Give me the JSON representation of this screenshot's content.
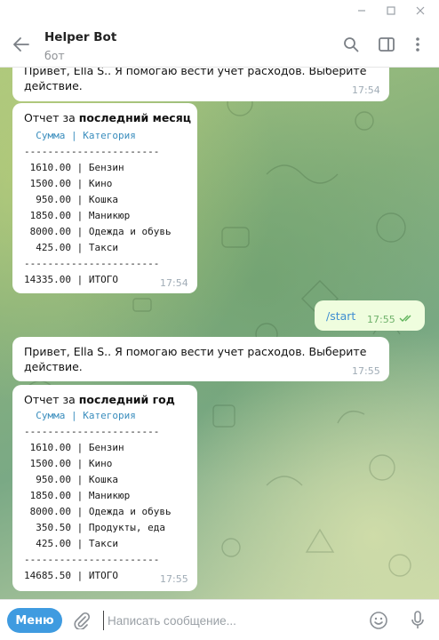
{
  "window": {
    "minimize_icon": "minimize-icon",
    "maximize_icon": "maximize-icon",
    "close_icon": "close-icon"
  },
  "header": {
    "title": "Helper Bot",
    "subtitle": "бот",
    "icons": [
      "back-arrow-icon",
      "search-icon",
      "side-panel-icon",
      "more-vertical-icon"
    ]
  },
  "messages": {
    "m1": {
      "text_line1": "Привет, Ella S.. Я помогаю вести учет расходов. Выберите",
      "text_line2": "действие.",
      "time": "17:54"
    },
    "m2": {
      "title_prefix": "Отчет за ",
      "title_bold": "последний месяц",
      "table_header": "  Сумма | Категория",
      "separator": "-----------------------",
      "rows": [
        " 1610.00 | Бензин",
        " 1500.00 | Кино",
        "  950.00 | Кошка",
        " 1850.00 | Маникюр",
        " 8000.00 | Одежда и обувь",
        "  425.00 | Такси"
      ],
      "total": "14335.00 | ИТОГО",
      "time": "17:54"
    },
    "m3": {
      "text": "/start",
      "time": "17:55",
      "status_icon": "double-check-icon"
    },
    "m4": {
      "text_line1": "Привет, Ella S.. Я помогаю вести учет расходов. Выберите",
      "text_line2": "действие.",
      "time": "17:55"
    },
    "m5": {
      "title_prefix": "Отчет за ",
      "title_bold": "последний год",
      "table_header": "  Сумма | Категория",
      "separator": "-----------------------",
      "rows": [
        " 1610.00 | Бензин",
        " 1500.00 | Кино",
        "  950.00 | Кошка",
        " 1850.00 | Маникюр",
        " 8000.00 | Одежда и обувь",
        "  350.50 | Продукты, еда",
        "  425.00 | Такси"
      ],
      "total": "14685.50 | ИТОГО",
      "time": "17:55"
    }
  },
  "composer": {
    "menu_label": "Меню",
    "placeholder": "Написать сообщение...",
    "value": "",
    "icons": [
      "paperclip-icon",
      "emoji-icon",
      "microphone-icon"
    ]
  },
  "colors": {
    "accent": "#3f9be0",
    "outgoing_bubble": "#effdde",
    "link": "#3f8ed1",
    "mono_header": "#3a8dbd"
  }
}
